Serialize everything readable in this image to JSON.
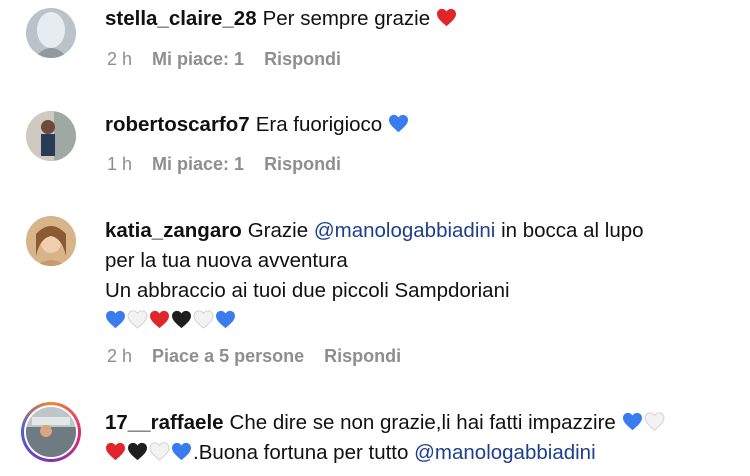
{
  "comments": [
    {
      "username": "stella_claire_28",
      "text": "Per sempre grazie",
      "emojis": [
        "red"
      ],
      "time": "2 h",
      "likes": "Mi piace: 1",
      "reply": "Rispondi"
    },
    {
      "username": "robertoscarfo7",
      "text": "Era fuorigioco",
      "emojis": [
        "blue"
      ],
      "time": "1 h",
      "likes": "Mi piace: 1",
      "reply": "Rispondi"
    },
    {
      "username": "katia_zangaro",
      "text_before": "Grazie",
      "mention": "@manologabbiadini",
      "text_after": "in bocca al lupo",
      "line2": "per la tua nuova avventura",
      "line3": "Un abbraccio ai tuoi due piccoli Sampdoriani",
      "emojis": [
        "blue",
        "white",
        "red",
        "black",
        "white",
        "blue"
      ],
      "time": "2 h",
      "likes": "Piace a 5 persone",
      "reply": "Rispondi"
    },
    {
      "username": "17__raffaele",
      "text": "Che dire se non grazie,li hai fatti impazzire",
      "emojis_line1": [
        "blue",
        "white"
      ],
      "emojis_line2": [
        "red",
        "black",
        "white",
        "blue"
      ],
      "text2": ".Buona fortuna per tutto",
      "mention": "@manologabbiadini"
    }
  ],
  "heart_colors": {
    "red": "#e0262b",
    "blue": "#3a7bf0",
    "white": "#f2f2f2",
    "black": "#1e1e1e"
  }
}
